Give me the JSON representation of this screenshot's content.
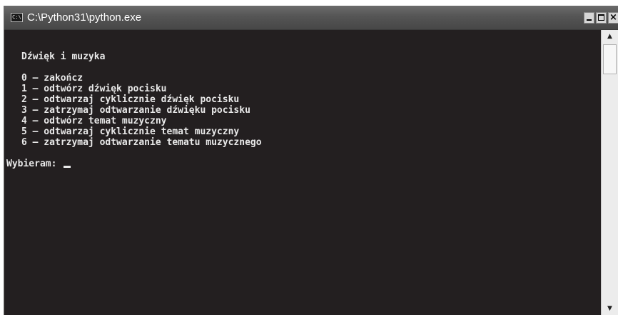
{
  "window": {
    "title": "C:\\Python31\\python.exe",
    "icon_label": "C:\\",
    "controls": {
      "minimize": "",
      "maximize": "",
      "close": "×"
    }
  },
  "console": {
    "heading": "Dźwięk i muzyka",
    "menu": [
      "0 – zakończ",
      "1 – odtwórz dźwięk pocisku",
      "2 – odtwarzaj cyklicznie dźwięk pocisku",
      "3 – zatrzymaj odtwarzanie dźwięku pocisku",
      "4 – odtwórz temat muzyczny",
      "5 – odtwarzaj cyklicznie temat muzyczny",
      "6 – zatrzymaj odtwarzanie tematu muzycznego"
    ],
    "prompt": "Wybieram: "
  },
  "scrollbar": {
    "up_icon": "▲",
    "down_icon": "▼"
  },
  "colors": {
    "console_bg": "#231f20",
    "console_fg": "#e8e8e8",
    "titlebar": "#555555"
  }
}
